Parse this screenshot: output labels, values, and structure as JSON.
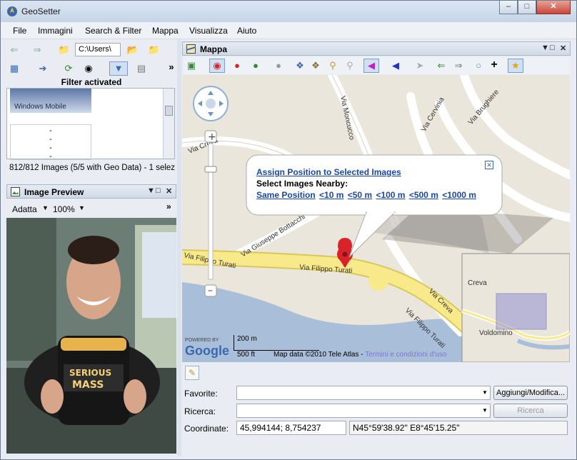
{
  "app": {
    "title": "GeoSetter"
  },
  "menu": [
    "File",
    "Immagini",
    "Search & Filter",
    "Mappa",
    "Visualizza",
    "Aiuto"
  ],
  "path_field": "C:\\Users\\",
  "filter_label": "Filter activated",
  "thumb_caption": "Windows Mobile",
  "list_dashes": [
    "-",
    "-",
    "-",
    "-",
    "-"
  ],
  "status_text": "812/812 Images (5/5 with Geo Data) - 1 selez",
  "image_preview": {
    "title": "Image Preview",
    "fit_label": "Adatta",
    "zoom_label": "100%",
    "tub_text_1": "SERIOUS",
    "tub_text_2": "MASS"
  },
  "map_panel": {
    "title": "Mappa",
    "streets": [
      "Via Creva",
      "Via Moncucco",
      "Via Cervinia",
      "Via Brughiere",
      "Via Giuseppe Bottacchi",
      "Via Filippo Turati",
      "Via Filippo Turati",
      "Via Filippo Turati",
      "Via Creva",
      "Via Creva"
    ],
    "popup": {
      "assign": "Assign Position to Selected Images",
      "nearby": "Select Images Nearby:",
      "links": [
        "Same Position",
        "<10 m",
        "<50 m",
        "<100 m",
        "<500 m",
        "<1000 m"
      ]
    },
    "scale_m": "200 m",
    "scale_ft": "500 ft",
    "powered_by": "POWERED BY",
    "google": "Google",
    "copyright": "Map data ©2010 Tele Atlas - ",
    "terms": "Termini e condizioni d'uso",
    "overview_labels": [
      "Creva",
      "Voldomino"
    ]
  },
  "bottom": {
    "favorite_label": "Favorite:",
    "favorite_value": "",
    "add_button": "Aggiungi/Modifica...",
    "search_label": "Ricerca:",
    "search_value": "",
    "search_button": "Ricerca",
    "coords_label": "Coordinate:",
    "coords_decimal": "45,994144; 8,754237",
    "coords_dms": "N45°59'38.92\" E8°45'15.25\""
  },
  "colors": {
    "road_yellow": "#f8e98a",
    "link_blue": "#1846a8",
    "marker_red": "#d8232a"
  }
}
